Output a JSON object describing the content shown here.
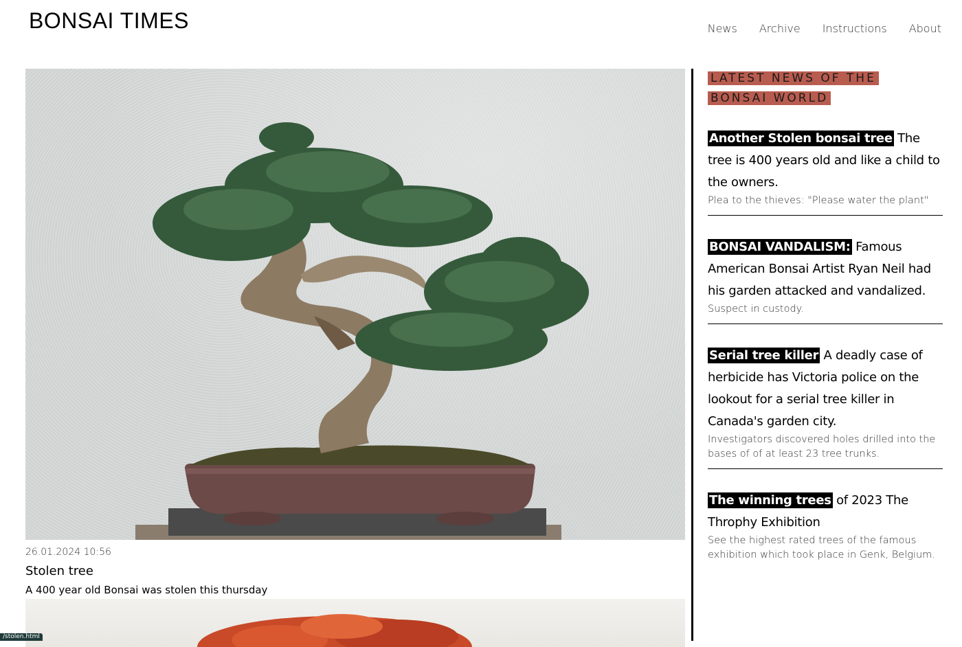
{
  "site": {
    "title": "BONSAI TIMES"
  },
  "nav": {
    "items": [
      "News",
      "Archive",
      "Instructions",
      "About"
    ]
  },
  "article": {
    "date": "26.01.2024 10:56",
    "title": "Stolen tree",
    "subtitle": "A 400 year old Bonsai was stolen this thursday"
  },
  "sidebar": {
    "heading": "LATEST NEWS OF THE BONSAI WORLD",
    "items": [
      {
        "tag": "Another Stolen bonsai tree",
        "lead": " The tree is 400 years old and like a child to the owners.",
        "desc": "Plea to the thieves: \"Please water the plant\""
      },
      {
        "tag": "BONSAI VANDALISM:",
        "lead": " Famous American Bonsai Artist Ryan Neil had his garden attacked and vandalized.",
        "desc": "Suspect in custody."
      },
      {
        "tag": "Serial tree killer",
        "lead": " A deadly case of herbicide has Victoria police on the lookout for a serial tree killer in Canada's garden city.",
        "desc": "Investigators discovered holes drilled into the bases of of at least 23 tree trunks."
      },
      {
        "tag": "The winning trees",
        "lead": " of 2023 The Throphy Exhibition",
        "desc": "See the highest rated trees of the famous exhibition which took place in Genk, Belgium."
      }
    ]
  },
  "status": {
    "url": "/stolen.html"
  },
  "colors": {
    "accent": "#b85c4f",
    "tag_bg": "#000000",
    "divider": "#000000"
  }
}
